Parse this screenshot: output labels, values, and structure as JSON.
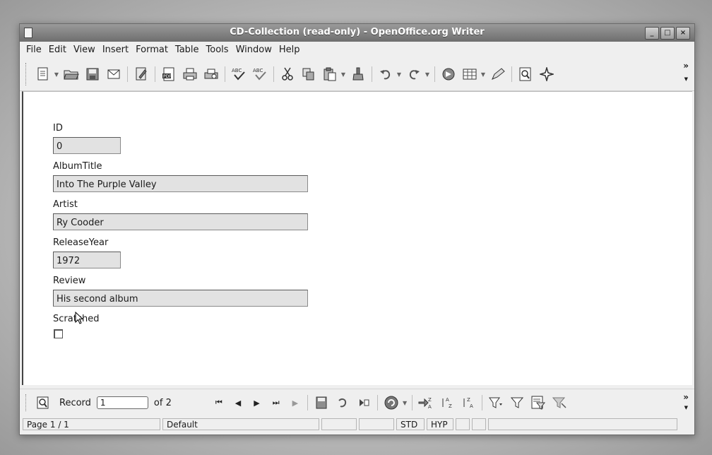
{
  "window": {
    "title": "CD-Collection (read-only) - OpenOffice.org Writer",
    "controls": [
      "_",
      "□",
      "×"
    ]
  },
  "menubar": {
    "items": [
      "File",
      "Edit",
      "View",
      "Insert",
      "Format",
      "Table",
      "Tools",
      "Window",
      "Help"
    ]
  },
  "toolbar": {
    "more": "»",
    "buttons": [
      "new-icon",
      "open-icon",
      "save-icon",
      "email-icon",
      "edit-file-icon",
      "export-pdf-icon",
      "print-icon",
      "print-preview-icon",
      "spellcheck-icon",
      "autospellcheck-icon",
      "cut-icon",
      "copy-icon",
      "paste-icon",
      "format-paintbrush-icon",
      "undo-icon",
      "redo-icon",
      "navigator-icon",
      "table-icon",
      "draw-functions-icon",
      "find-icon",
      "gallery-icon"
    ]
  },
  "form": {
    "id_label": "ID",
    "id_value": "0",
    "album_label": "AlbumTitle",
    "album_value": "Into The Purple Valley",
    "artist_label": "Artist",
    "artist_value": "Ry Cooder",
    "year_label": "ReleaseYear",
    "year_value": "1972",
    "review_label": "Review",
    "review_value": "His second album",
    "scratched_label": "Scratched",
    "scratched_checked": false
  },
  "navbar": {
    "record_label": "Record",
    "record_value": "1",
    "of_label": "of 2"
  },
  "statusbar": {
    "page": "Page 1 / 1",
    "style": "Default",
    "mode": "STD",
    "hyphen": "HYP"
  }
}
